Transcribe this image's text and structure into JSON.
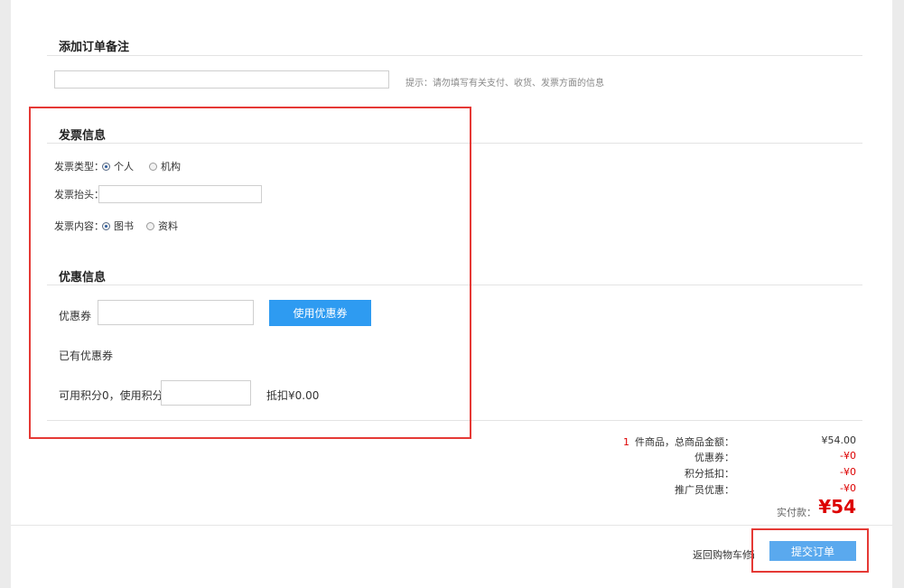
{
  "remark": {
    "title": "添加订单备注",
    "input_value": "",
    "hint": "提示：请勿填写有关支付、收货、发票方面的信息"
  },
  "invoice": {
    "title": "发票信息",
    "type_label": "发票类型：",
    "type_options": [
      "个人",
      "机构"
    ],
    "type_selected": "个人",
    "header_label": "发票抬头：",
    "header_value": "",
    "content_label": "发票内容：",
    "content_options": [
      "图书",
      "资料"
    ],
    "content_selected": "图书"
  },
  "discount": {
    "title": "优惠信息",
    "coupon_label": "优惠券",
    "coupon_value": "",
    "use_coupon_button": "使用优惠券",
    "existing_coupons": "已有优惠券",
    "points_label": "可用积分0，使用积分",
    "points_value": "",
    "deduction": "抵扣¥0.00"
  },
  "summary": {
    "item_count": "1",
    "item_text": "件商品，总商品金额：",
    "total_amount": "¥54.00",
    "coupon_label": "优惠券：",
    "coupon_amount": "-¥0",
    "points_label": "积分抵扣：",
    "points_amount": "-¥0",
    "promoter_label": "推广员优惠：",
    "promoter_amount": "-¥0",
    "pay_label": "实付款：",
    "pay_amount": "¥54"
  },
  "footer": {
    "back_link": "返回购物车修改",
    "submit_button": "提交订单"
  },
  "colors": {
    "accent_blue": "#2e9bf1",
    "submit_blue": "#5aa9ee",
    "price_red": "#d00000",
    "highlight_red": "#e53935"
  }
}
